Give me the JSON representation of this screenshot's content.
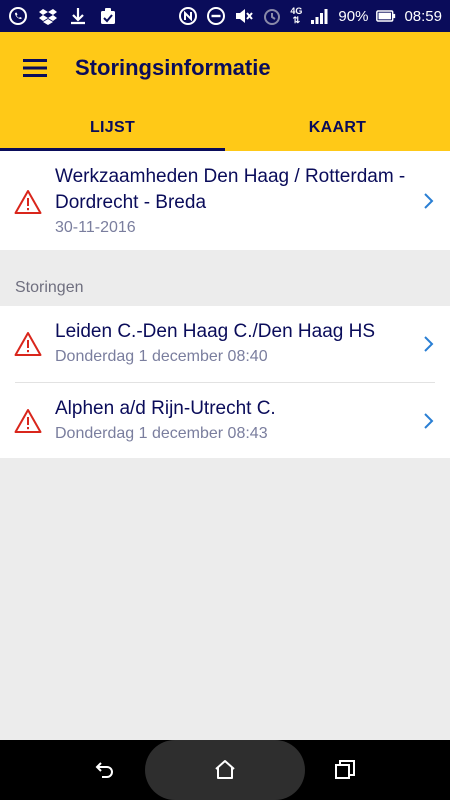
{
  "statusbar": {
    "battery_percent": "90%",
    "time": "08:59",
    "network_top": "4G",
    "network_bottom": "⇅"
  },
  "header": {
    "title": "Storingsinformatie"
  },
  "tabs": [
    {
      "label": "LIJST",
      "active": true
    },
    {
      "label": "KAART",
      "active": false
    }
  ],
  "works": {
    "items": [
      {
        "title": "Werkzaamheden Den Haag / Rotterdam - Dordrecht - Breda",
        "date": "30-11-2016"
      }
    ]
  },
  "disruptions": {
    "section_label": "Storingen",
    "items": [
      {
        "title": "Leiden C.-Den Haag C./Den Haag HS",
        "date": "Donderdag 1 december 08:40"
      },
      {
        "title": "Alphen a/d Rijn-Utrecht C.",
        "date": "Donderdag 1 december 08:43"
      }
    ]
  },
  "colors": {
    "brand_yellow": "#ffc917",
    "brand_blue": "#0a0c5a",
    "warning_red": "#d9261c",
    "chevron_blue": "#2a7fd4"
  }
}
